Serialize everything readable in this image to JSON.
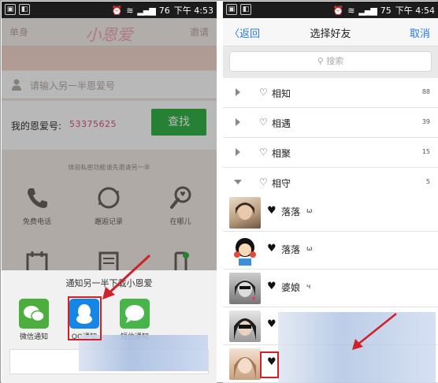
{
  "left": {
    "status": {
      "battery": "76",
      "time": "下午 4:53"
    },
    "header": {
      "left_label": "单身",
      "logo": "小恩爱",
      "right_label": "邀请"
    },
    "input_placeholder": "请输入另一半恩爱号",
    "my_id_label": "我的恩爱号:",
    "my_id_value": "53375625",
    "find_button": "查找",
    "hint": "体验私密功能请先邀请另一半",
    "grid": [
      {
        "label": "免费电话",
        "icon": "phone-icon"
      },
      {
        "label": "邂逅记录",
        "icon": "sync-icon"
      },
      {
        "label": "在哪儿",
        "icon": "location-pin-icon"
      },
      {
        "label": "",
        "icon": "calendar-icon"
      },
      {
        "label": "",
        "icon": "list-icon"
      },
      {
        "label": "",
        "icon": "phone-device-icon"
      }
    ],
    "share_sheet": {
      "title": "通知另一半下载小恩爱",
      "options": [
        {
          "label": "微信通知",
          "icon": "wechat-icon",
          "color": "#4cae3c"
        },
        {
          "label": "QQ通知",
          "icon": "qq-penguin-icon",
          "color": "#1686e6"
        },
        {
          "label": "短信通知",
          "icon": "sms-icon",
          "color": "#47b54a"
        }
      ]
    }
  },
  "right": {
    "status": {
      "battery": "75",
      "time": "下午 4:54"
    },
    "nav": {
      "back": "返回",
      "title": "选择好友",
      "cancel": "取消"
    },
    "search_placeholder": "搜索",
    "groups": [
      {
        "name": "相知",
        "count": "88",
        "expanded": false
      },
      {
        "name": "相遇",
        "count": "39",
        "expanded": false
      },
      {
        "name": "相聚",
        "count": "15",
        "expanded": false
      },
      {
        "name": "相守",
        "count": "5",
        "expanded": true
      }
    ],
    "friends": [
      {
        "name": "落落",
        "suffix": "ω"
      },
      {
        "name": "落落",
        "suffix": "ω"
      },
      {
        "name": "婆娘",
        "suffix": "ч"
      },
      {
        "name": "",
        "suffix": ""
      },
      {
        "name": "",
        "suffix": ""
      }
    ]
  },
  "colors": {
    "accent_blue": "#2a7ae2",
    "find_green": "#37b349",
    "highlight_red": "#d0202a",
    "id_pink": "#e0508a"
  }
}
